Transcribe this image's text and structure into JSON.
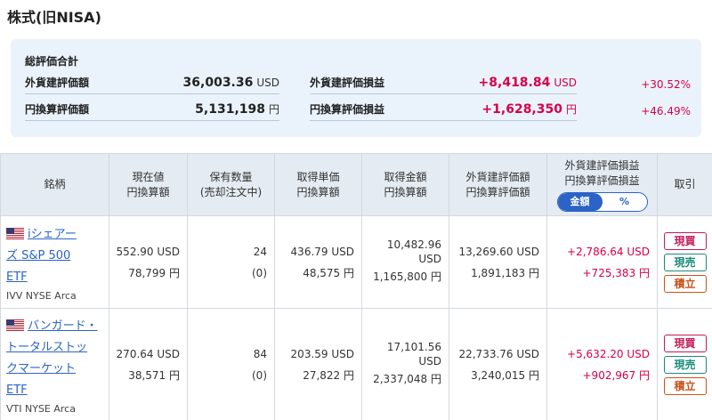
{
  "page": {
    "title": "株式(旧NISA)"
  },
  "summary": {
    "title": "総評価合計",
    "foreign_eval": {
      "label": "外貨建評価額",
      "value": "36,003.36",
      "unit": "USD"
    },
    "jpy_eval": {
      "label": "円換算評価額",
      "value": "5,131,198",
      "unit": "円"
    },
    "foreign_pl": {
      "label": "外貨建評価損益",
      "value": "+8,418.84",
      "unit": "USD",
      "pct": "+30.52%"
    },
    "jpy_pl": {
      "label": "円換算評価損益",
      "value": "+1,628,350",
      "unit": "円",
      "pct": "+46.49%"
    }
  },
  "table": {
    "headers": {
      "name": "銘柄",
      "price": [
        "現在値",
        "円換算額"
      ],
      "qty": [
        "保有数量",
        "(売却注文中)"
      ],
      "cost": [
        "取得単価",
        "円換算額"
      ],
      "cost_total": [
        "取得金額",
        "円換算額"
      ],
      "eval": [
        "外貨建評価額",
        "円換算評価額"
      ],
      "pl": [
        "外貨建評価損益",
        "円換算評価損益"
      ],
      "trade": "取引"
    },
    "toggle": {
      "amount": "金額",
      "percent": "%"
    },
    "buttons": {
      "buy": "現買",
      "sell": "現売",
      "accum": "積立"
    },
    "rows": [
      {
        "name": "iシェアーズ S&P 500 ETF",
        "name_lines": [
          "iシェアー",
          "ズ S&P 500",
          "ETF"
        ],
        "ticker": "IVV NYSE Arca",
        "price_usd": "552.90 USD",
        "price_jpy": "78,799 円",
        "qty": "24",
        "qty_pending": "(0)",
        "cost_usd": "436.79 USD",
        "cost_jpy": "48,575 円",
        "cost_total_usd_1": "10,482.96",
        "cost_total_usd_2": "USD",
        "cost_total_jpy": "1,165,800 円",
        "eval_usd": "13,269.60 USD",
        "eval_jpy": "1,891,183 円",
        "pl_usd": "+2,786.64 USD",
        "pl_jpy": "+725,383 円"
      },
      {
        "name": "バンガード・トータルストックマーケットETF",
        "name_lines": [
          "バンガード・",
          "トータルストッ",
          "クマーケット",
          "ETF"
        ],
        "ticker": "VTI NYSE Arca",
        "price_usd": "270.64 USD",
        "price_jpy": "38,571 円",
        "qty": "84",
        "qty_pending": "(0)",
        "cost_usd": "203.59 USD",
        "cost_jpy": "27,822 円",
        "cost_total_usd_1": "17,101.56",
        "cost_total_usd_2": "USD",
        "cost_total_jpy": "2,337,048 円",
        "eval_usd": "22,733.76 USD",
        "eval_jpy": "3,240,015 円",
        "pl_usd": "+5,632.20 USD",
        "pl_jpy": "+902,967 円"
      }
    ]
  }
}
